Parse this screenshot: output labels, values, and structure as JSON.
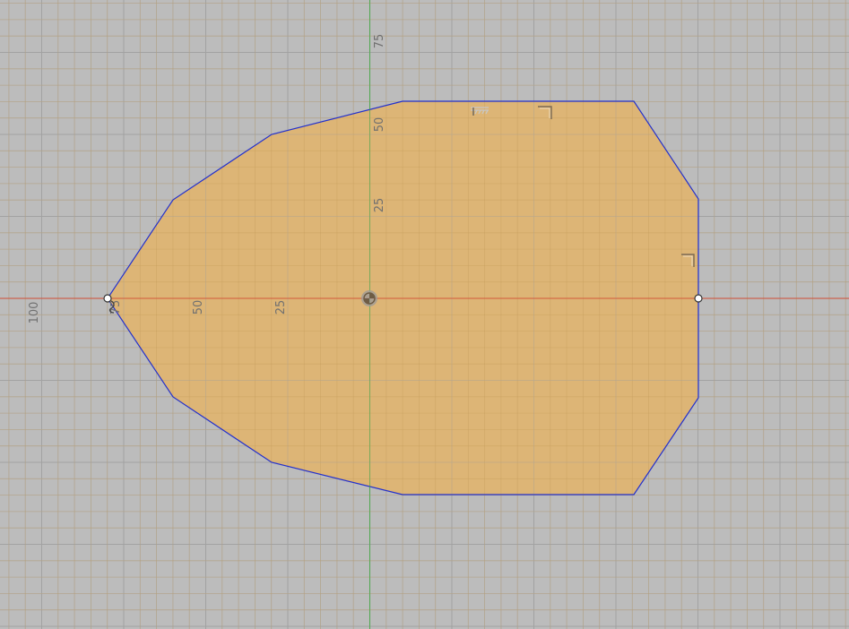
{
  "view": {
    "background": "#bcbcbc",
    "grid_minor_color": "#adadad",
    "grid_major_color": "#a2a2a2",
    "x_axis_color": "#d4462c",
    "y_axis_color": "#3fa83f",
    "profile_fill": "#e3b46a",
    "profile_stroke": "#2330cc"
  },
  "axis_labels": {
    "x": [
      "100",
      "75",
      "50",
      "25"
    ],
    "y": [
      "75",
      "50",
      "25"
    ]
  },
  "constraint_icons": [
    "fix-constraint-icon",
    "perpendicular-constraint-icon",
    "perpendicular-constraint-icon",
    "tangent-constraint-icon"
  ],
  "origin_icon": "origin-icon"
}
